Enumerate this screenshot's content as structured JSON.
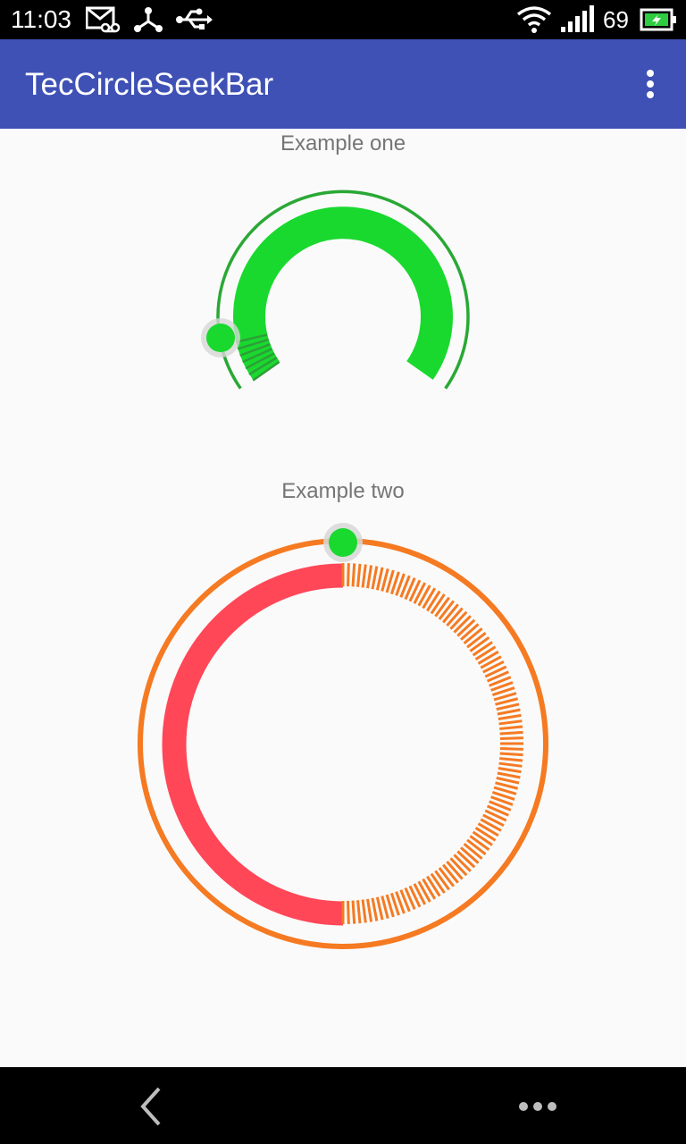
{
  "status_bar": {
    "time": "11:03",
    "battery_level": "69",
    "icons": [
      "voicemail-icon",
      "share-hub-icon",
      "usb-icon",
      "wifi-icon",
      "signal-icon",
      "battery-charging-icon"
    ]
  },
  "app_bar": {
    "title": "TecCircleSeekBar",
    "menu_icon": "overflow-menu-icon"
  },
  "example_one": {
    "label": "Example one",
    "progress_fraction": 0.07,
    "colors": {
      "ring": "#19d92e",
      "outline": "#2aa835",
      "thumb": "#19d92e",
      "ticks": "#2e9e38"
    }
  },
  "example_two": {
    "label": "Example two",
    "progress_fraction": 0.0,
    "colors": {
      "left_arc": "#ff4757",
      "ticks": "#f57a22",
      "outline": "#f57a22",
      "thumb": "#19d92e"
    }
  },
  "nav_bar": {
    "icons": [
      "back-icon",
      "more-icon"
    ]
  }
}
